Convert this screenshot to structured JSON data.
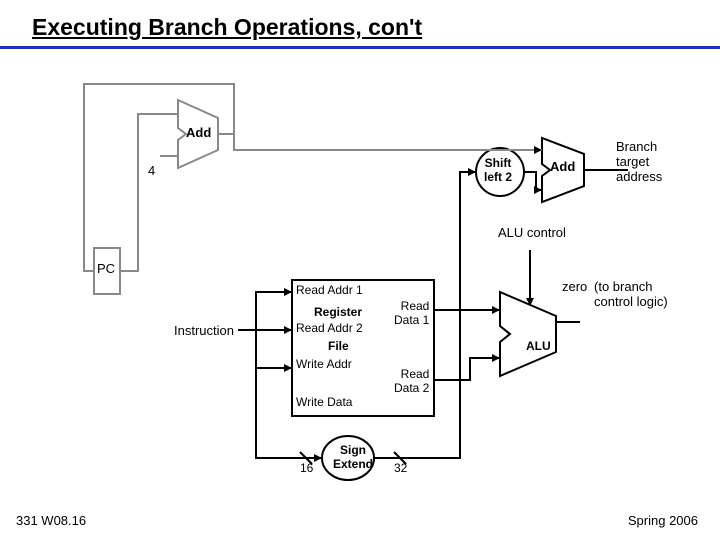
{
  "title": "Executing Branch Operations, con't",
  "footer": {
    "left": "331 W08.16",
    "right": "Spring 2006"
  },
  "labels": {
    "add1": "Add",
    "four": "4",
    "shift": "Shift\nleft 2",
    "add2": "Add",
    "branchTarget": "Branch\ntarget\naddress",
    "aluControl": "ALU control",
    "pc": "PC",
    "instruction": "Instruction",
    "regfile": {
      "readAddr1": "Read Addr 1",
      "register": "Register",
      "readAddr2": "Read Addr 2",
      "file": "File",
      "writeAddr": "Write Addr",
      "writeData": "Write Data",
      "readData1": "Read\nData 1",
      "readData2": "Read\nData 2"
    },
    "zero": "zero",
    "zeroNote": "(to branch\ncontrol logic)",
    "alu": "ALU",
    "signExtend": "Sign\nExtend",
    "sixteen": "16",
    "thirtytwo": "32"
  }
}
